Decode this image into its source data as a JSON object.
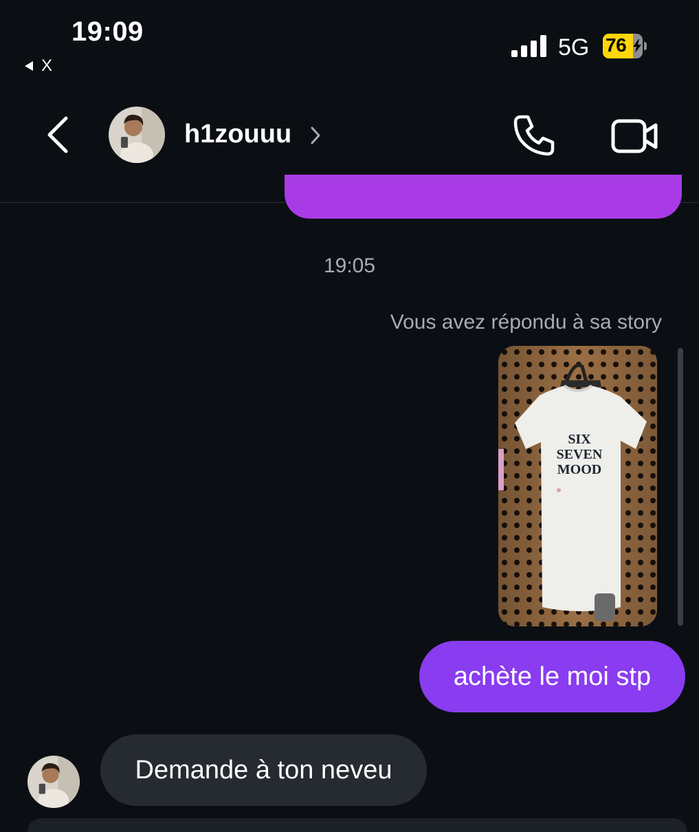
{
  "status_bar": {
    "time": "19:09",
    "back_app_label": "X",
    "network": "5G",
    "battery_level": "76",
    "battery_fraction": 0.76
  },
  "header": {
    "username": "h1zouuu"
  },
  "thread": {
    "timestamp": "19:05",
    "story_reply_label": "Vous avez répondu à sa story",
    "story_image_text": [
      "SIX",
      "SEVEN",
      "MOOD"
    ],
    "messages": [
      {
        "direction": "sent",
        "text": "achète le moi stp"
      },
      {
        "direction": "received",
        "text": "Demande à ton neveu"
      }
    ]
  },
  "colors": {
    "background": "#0b0f14",
    "sent_bubble": "#8a3cf0",
    "received_bubble": "#262a31",
    "battery_accent": "#ffd60a"
  },
  "icons": [
    "back-chevron-icon",
    "phone-icon",
    "video-camera-icon",
    "signal-icon"
  ]
}
